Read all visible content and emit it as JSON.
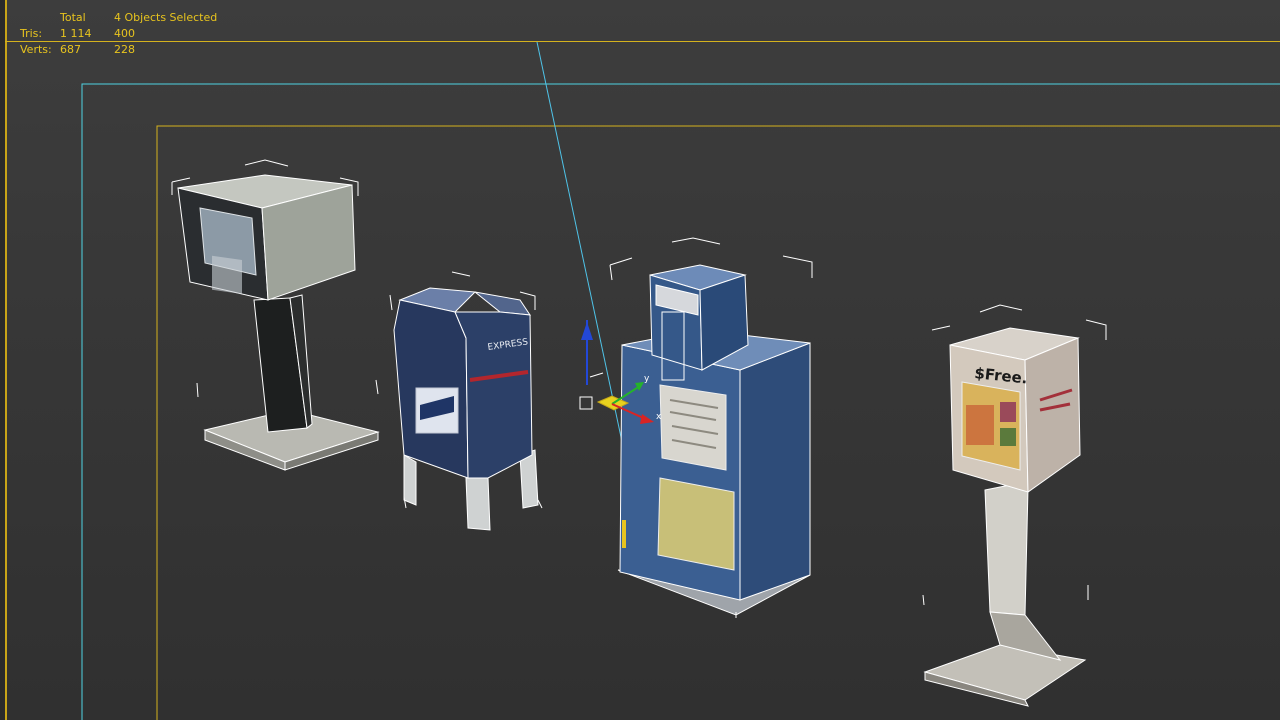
{
  "viewport": {
    "stats": {
      "header_total": "Total",
      "header_selected": "4 Objects Selected",
      "rows": [
        {
          "label": "Tris:",
          "total": "1 114",
          "selected": "400"
        },
        {
          "label": "Verts:",
          "total": "687",
          "selected": "228"
        }
      ]
    },
    "objects": [
      {
        "name": "Newspaper dispenser on stand"
      },
      {
        "name": "Mailbox"
      },
      {
        "name": "Newspaper vending box"
      },
      {
        "name": "Free magazine stand",
        "label": "$Free."
      }
    ],
    "mailbox_brand": "EXPRESS",
    "gizmo": {
      "x_label": "x",
      "y_label": "y"
    },
    "colors": {
      "stats_text": "#e8c41e",
      "frame_yellow": "#d4b21e",
      "frame_cyan": "#4fd3e3",
      "selection_wire": "#ffffff",
      "viewport_bg": "#383838"
    }
  }
}
